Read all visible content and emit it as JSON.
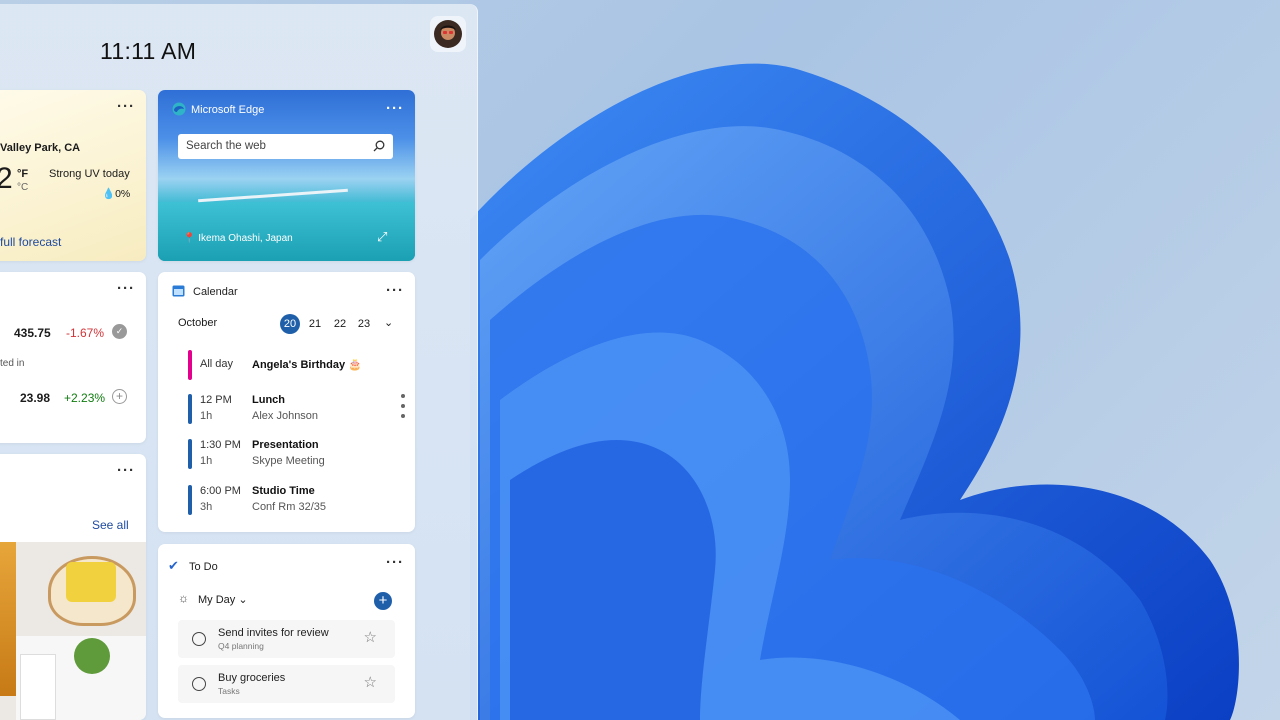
{
  "clock": {
    "time": "11:11 AM"
  },
  "weather": {
    "location": "Valley Park, CA",
    "temp_fragment": "2",
    "unit_f": "°F",
    "unit_c": "°C",
    "uv": "Strong UV today",
    "precip": "0%",
    "forecast_link": "full forecast"
  },
  "stocks": {
    "rows": [
      {
        "price": "435.75",
        "change": "-1.67%",
        "change_color": "#d13438"
      },
      {
        "price": "23.98",
        "change": "+2.23%",
        "change_color": "#107c10"
      }
    ],
    "middle_text": "ted in"
  },
  "photos": {
    "see_all": "See all"
  },
  "edge": {
    "title": "Microsoft Edge",
    "search_placeholder": "Search the web",
    "location": "Ikema Ohashi, Japan"
  },
  "calendar": {
    "title": "Calendar",
    "month": "October",
    "dates": [
      "20",
      "21",
      "22",
      "23"
    ],
    "events": [
      {
        "time": "All day",
        "duration": "",
        "title": "Angela's Birthday",
        "sub": "",
        "color": "#e3008c"
      },
      {
        "time": "12 PM",
        "duration": "1h",
        "title": "Lunch",
        "sub": "Alex  Johnson",
        "color": "#1f5faa"
      },
      {
        "time": "1:30 PM",
        "duration": "1h",
        "title": "Presentation",
        "sub": "Skype Meeting",
        "color": "#1f5faa"
      },
      {
        "time": "6:00 PM",
        "duration": "3h",
        "title": "Studio Time",
        "sub": "Conf Rm 32/35",
        "color": "#1f5faa"
      }
    ]
  },
  "todo": {
    "title": "To Do",
    "list": "My Day",
    "tasks": [
      {
        "title": "Send invites for review",
        "sub": "Q4 planning"
      },
      {
        "title": "Buy groceries",
        "sub": "Tasks"
      }
    ]
  },
  "colors": {
    "accent": "#1f5faa",
    "panel": "#dbe6f3",
    "bloom": "#1a63e0"
  }
}
